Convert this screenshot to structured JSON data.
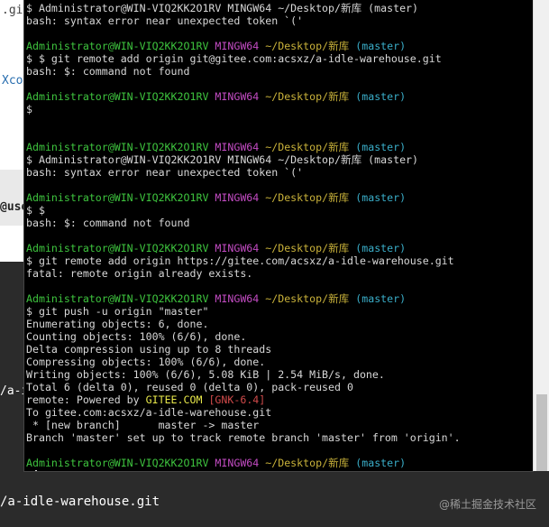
{
  "background": {
    "fragment_gi": ".gi",
    "fragment_xcod": "Xcod",
    "fragment_use": "@use",
    "fragment_a": "/a-i",
    "bottom_code": "/a-idle-warehouse.git",
    "watermark": "@稀土掘金技术社区"
  },
  "terminal": {
    "prompt_user": "Administrator@WIN-VIQ2KK2O1RV",
    "prompt_shell": "MINGW64",
    "prompt_path": "~/Desktop/新库",
    "prompt_branch": "(master)",
    "lines": [
      "$ Administrator@WIN-VIQ2KK2O1RV MINGW64 ~/Desktop/新库 (master)",
      "bash: syntax error near unexpected token `('",
      "$ $ git remote add origin git@gitee.com:acsxz/a-idle-warehouse.git",
      "bash: $: command not found",
      "$",
      "$ Administrator@WIN-VIQ2KK2O1RV MINGW64 ~/Desktop/新库 (master)",
      "bash: syntax error near unexpected token `('",
      "$ $",
      "bash: $: command not found",
      "$ git remote add origin https://gitee.com/acsxz/a-idle-warehouse.git",
      "fatal: remote origin already exists.",
      "$ git push -u origin \"master\"",
      "Enumerating objects: 6, done.",
      "Counting objects: 100% (6/6), done.",
      "Delta compression using up to 8 threads",
      "Compressing objects: 100% (6/6), done.",
      "Writing objects: 100% (6/6), 5.08 KiB | 2.54 MiB/s, done.",
      "Total 6 (delta 0), reused 0 (delta 0), pack-reused 0",
      "remote: Powered by ",
      "GITEE.COM",
      "[GNK-6.4]",
      "To gitee.com:acsxz/a-idle-warehouse.git",
      " * [new branch]      master -> master",
      "Branch 'master' set up to track remote branch 'master' from 'origin'.",
      "$"
    ]
  }
}
